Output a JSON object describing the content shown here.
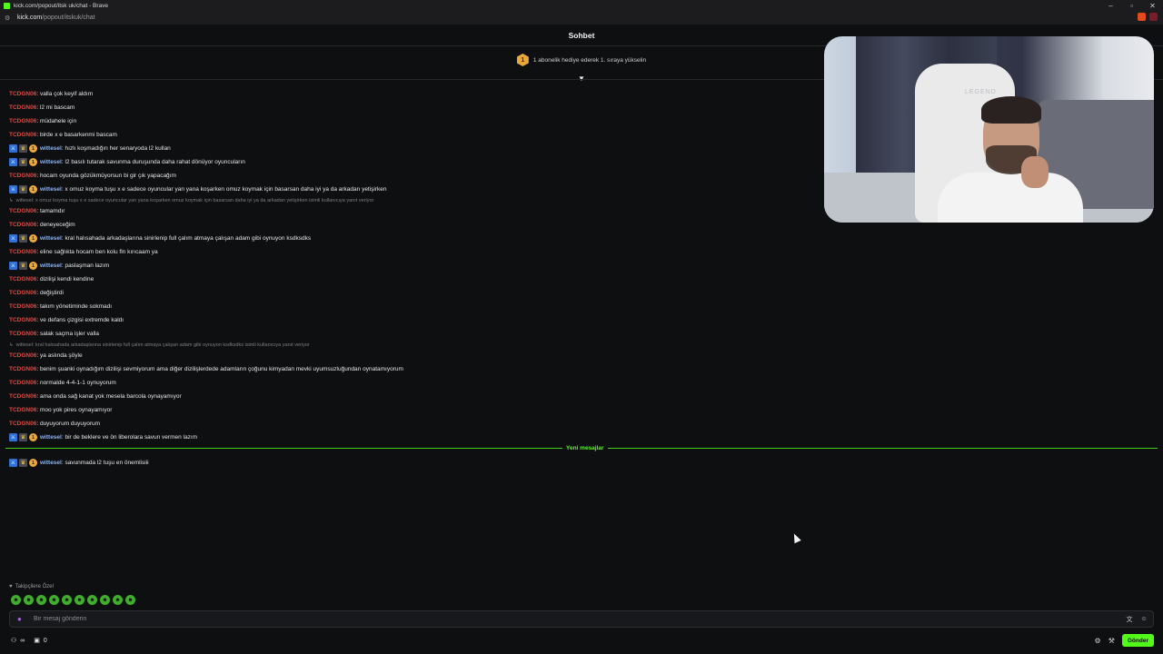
{
  "browser": {
    "window_title": "kick.com/popout/itsk uk/chat - Brave",
    "url_host": "kick.com",
    "url_path": "/popout/itskuk/chat",
    "win_minimize": "–",
    "win_maximize": "▫",
    "win_close": "✕"
  },
  "chat": {
    "title": "Sohbet",
    "promo_rank": "1",
    "promo_text": "1 abonelik hediye ederek 1. sıraya yükselin",
    "new_messages_label": "Yeni mesajlar"
  },
  "messages": [
    {
      "user": "TCDGN06",
      "text": ": valla çok keyif aldım"
    },
    {
      "user": "TCDGN06",
      "text": ": l2 mi bascam"
    },
    {
      "user": "TCDGN06",
      "text": ": müdahele için"
    },
    {
      "user": "TCDGN06",
      "text": ": birde x e basarkenmi bascam"
    },
    {
      "user": "wittesel",
      "text": ": hızlı koşmadığın her senaryoda l2 kullan"
    },
    {
      "user": "wittesel",
      "text": ": l2 basılı tutarak savunma duruşunda daha rahat dönüyor oyuncuların"
    },
    {
      "user": "TCDGN06",
      "text": ": hocam oyunda gözükmüyorsun bi gir çık yapacağım"
    },
    {
      "user": "wittesel",
      "text": ": x omuz koyma tuşu x e sadece oyuncular yan yana koşarken omuz koymak için basarsan daha iyi ya da arkadan yetişirken"
    },
    {
      "reply": "wittesel: x omuz koyma tuşu x e sadece oyuncular yan yana koşarken omuz koymak için basarsan daha iyi ya da arkadan yetişirken isimli kullanıcıya yanıt veriyor"
    },
    {
      "user": "TCDGN06",
      "text": ": tamamdır"
    },
    {
      "user": "TCDGN06",
      "text": ": deneyeceğim"
    },
    {
      "user": "wittesel",
      "text": ": kral halısahada arkadaşlarına sinirlenip full çalım atmaya çalışan adam gibi oynuyon ksdksdks"
    },
    {
      "user": "TCDGN06",
      "text": ": eline sağlıkta hocam ben kolu fln kırıcaam ya"
    },
    {
      "user": "wittesel",
      "text": ": paslaşman lazım"
    },
    {
      "user": "TCDGN06",
      "text": ": dizilişi kendi kendine"
    },
    {
      "user": "TCDGN06",
      "text": ": değiştirdi"
    },
    {
      "user": "TCDGN06",
      "text": ": takım yönetiminde sokmadı"
    },
    {
      "user": "TCDGN06",
      "text": ": ve defans çizgisi extremde kaldı"
    },
    {
      "user": "TCDGN06",
      "text": ": salak saçma işler valla"
    },
    {
      "reply": "wittesel: kral halısahada arkadaşlarına sinirlenip full çalım atmaya çalışan adam gibi oynuyon ksdksdks isimli kullanıcıya yanıt veriyor"
    },
    {
      "user": "TCDGN06",
      "text": ": ya aslında şöyle"
    },
    {
      "user": "TCDGN06",
      "text": ": benim şuanki oynadığım dizilişi sevmiyorum ama diğer dizilişlerdede adamların çoğunu kimyadan mevki uyumsuzluğundan oynatamıyorum"
    },
    {
      "user": "TCDGN06",
      "text": ": normalde 4-4-1-1 oynuyorum"
    },
    {
      "user": "TCDGN06",
      "text": ": ama onda sağ kanat yok mesela barcola oynayamıyor"
    },
    {
      "user": "TCDGN06",
      "text": ": moo yok pires oynayamıyor"
    },
    {
      "user": "TCDGN06",
      "text": ": duyuyorum duyuyorum"
    },
    {
      "user": "wittesel",
      "text": ": bir de beklere ve ön liberolara savun vermen lazım"
    }
  ],
  "after_divider": [
    {
      "user": "wittesel",
      "text": ": savunmada l2 tuşu en önemlisiii"
    }
  ],
  "webcam": {
    "brand": "LEGEND"
  },
  "composer": {
    "followers_label": "Takipçilere Özel",
    "placeholder": "Bir mesaj gönderin",
    "send_label": "Gönder",
    "viewer_label": "∞",
    "points_value": "0"
  },
  "colors": {
    "accent": "#53fc18",
    "username_red": "#e8453c",
    "username_blue": "#8ab4f8"
  }
}
